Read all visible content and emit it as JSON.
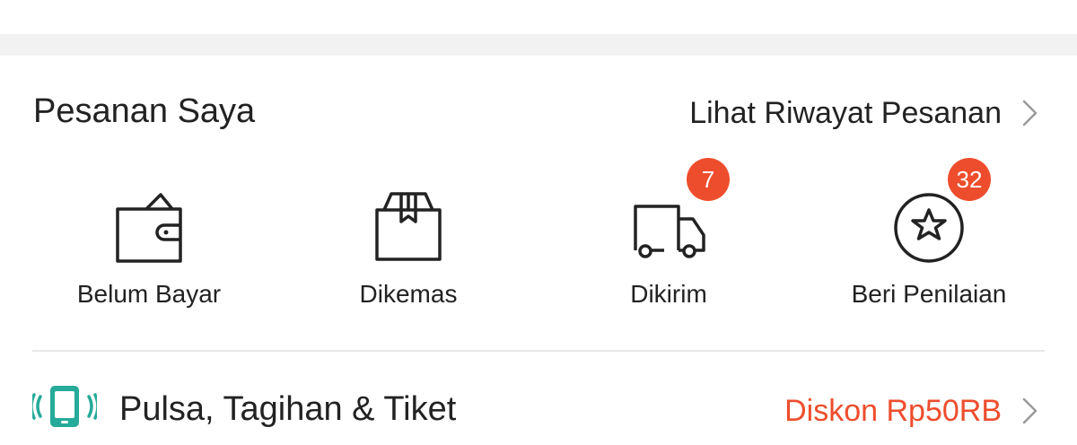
{
  "orders": {
    "title": "Pesanan Saya",
    "history_link": "Lihat Riwayat Pesanan",
    "statuses": [
      {
        "label": "Belum Bayar",
        "icon": "wallet-icon",
        "badge": ""
      },
      {
        "label": "Dikemas",
        "icon": "package-icon",
        "badge": ""
      },
      {
        "label": "Dikirim",
        "icon": "truck-icon",
        "badge": "7"
      },
      {
        "label": "Beri Penilaian",
        "icon": "star-icon",
        "badge": "32"
      }
    ]
  },
  "bills": {
    "label": "Pulsa, Tagihan & Tiket",
    "promo": "Diskon Rp50RB",
    "icon": "phone-vibrate-icon"
  },
  "colors": {
    "accent": "#ee4d2d",
    "teal": "#26aa99",
    "text": "#222222",
    "separator": "#f2f2f2"
  }
}
